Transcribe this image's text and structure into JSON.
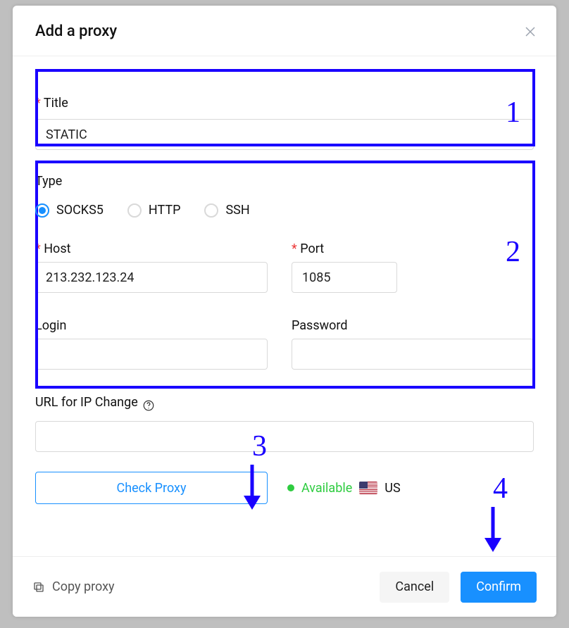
{
  "modal": {
    "title": "Add a proxy"
  },
  "form": {
    "title_label": "Title",
    "title_value": "STATIC",
    "type_label": "Type",
    "types": {
      "socks5": "SOCKS5",
      "http": "HTTP",
      "ssh": "SSH",
      "selected": "socks5"
    },
    "host_label": "Host",
    "host_value": "213.232.123.24",
    "port_label": "Port",
    "port_value": "1085",
    "login_label": "Login",
    "login_value": "",
    "password_label": "Password",
    "password_value": "",
    "url_label": "URL for IP Change",
    "url_value": ""
  },
  "check": {
    "button": "Check Proxy",
    "status": "Available",
    "country": "US"
  },
  "footer": {
    "copy": "Copy proxy",
    "cancel": "Cancel",
    "confirm": "Confirm"
  },
  "annotations": {
    "1": "1",
    "2": "2",
    "3": "3",
    "4": "4"
  }
}
